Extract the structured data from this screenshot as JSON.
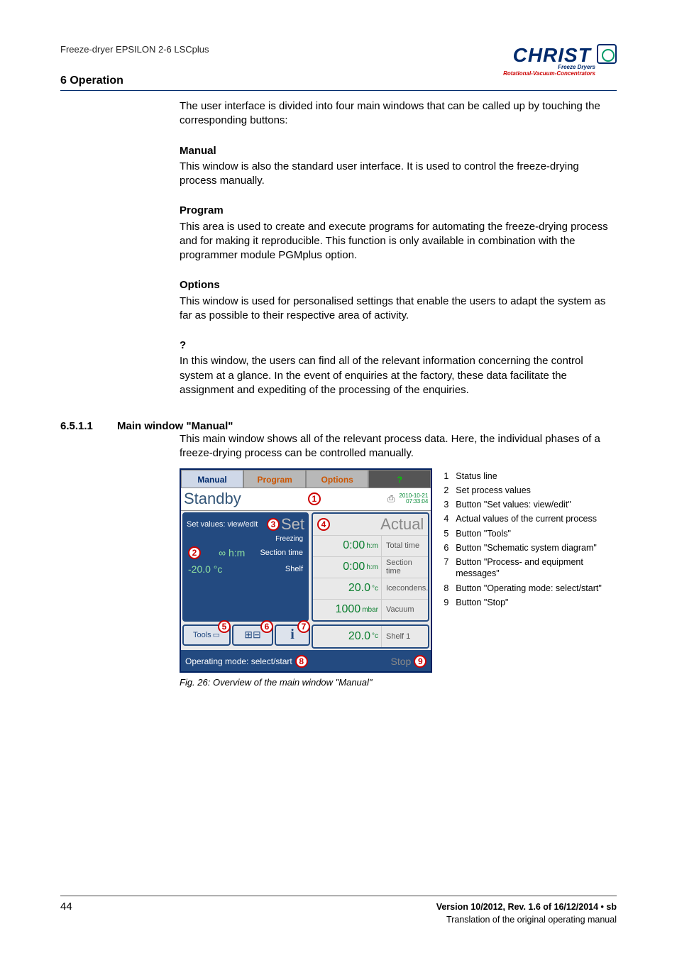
{
  "doc_title": "Freeze-dryer EPSILON 2-6 LSCplus",
  "section_title": "6 Operation",
  "logo": {
    "brand": "CHRIST",
    "sub1": "Freeze Dryers",
    "sub2": "Rotational-Vacuum-Concentrators"
  },
  "intro": "The user interface is divided into four main windows that can be called up by touching the corresponding buttons:",
  "blocks": [
    {
      "h": "Manual",
      "p": "This window is also the standard user interface. It is used to control the freeze-drying process manually."
    },
    {
      "h": "Program",
      "p": "This area is used to create and execute programs for automating the freeze-drying process and for making it reproducible. This function is only available in combination with the programmer module PGMplus option."
    },
    {
      "h": "Options",
      "p": "This window is used for personalised settings that enable the users to adapt the system as far as possible to their respective area of activity."
    },
    {
      "h": "?",
      "p": "In this window, the users can find all of the relevant information concerning the control system at a glance. In the event of enquiries at the factory, these data facilitate the assignment and expediting of the processing of the enquiries."
    }
  ],
  "subsection": {
    "num": "6.5.1.1",
    "title": "Main window \"Manual\"",
    "desc": "This main window shows all of the relevant process data. Here, the individual phases of a freeze-drying process can be controlled manually."
  },
  "screenshot": {
    "tabs": {
      "manual": "Manual",
      "program": "Program",
      "options": "Options",
      "q": "?"
    },
    "status": "Standby",
    "date": "2010-10-21",
    "time": "07:33:04",
    "set_header": "Set values: view/edit",
    "set_big": "Set",
    "freezing": "Freezing",
    "set_rows": [
      {
        "val": "∞ h:m",
        "lbl": "Section time"
      },
      {
        "val": "-20.0 °c",
        "lbl": "Shelf"
      }
    ],
    "actual_big": "Actual",
    "actual_rows": [
      {
        "val": "0:00",
        "unit": "h:m",
        "lbl": "Total time"
      },
      {
        "val": "0:00",
        "unit": "h:m",
        "lbl": "Section time"
      },
      {
        "val": "20.0",
        "unit": "°c",
        "lbl": "Icecondens."
      },
      {
        "val": "1000",
        "unit": "mbar",
        "lbl": "Vacuum"
      },
      {
        "val": "20.0",
        "unit": "°c",
        "lbl": "Shelf 1"
      }
    ],
    "tools_label": "Tools",
    "bottom_left": "Operating mode: select/start",
    "bottom_right": "Stop"
  },
  "legend": [
    {
      "n": "1",
      "t": "Status line"
    },
    {
      "n": "2",
      "t": "Set process values"
    },
    {
      "n": "3",
      "t": "Button \"Set values: view/edit\""
    },
    {
      "n": "4",
      "t": "Actual values of the current process"
    },
    {
      "n": "5",
      "t": "Button \"Tools\""
    },
    {
      "n": "6",
      "t": "Button \"Schematic system diagram\""
    },
    {
      "n": "7",
      "t": "Button \"Process- and equipment messages\""
    },
    {
      "n": "8",
      "t": "Button \"Operating mode: select/start\""
    },
    {
      "n": "9",
      "t": "Button \"Stop\""
    }
  ],
  "fig_caption": "Fig. 26: Overview of the main window \"Manual\"",
  "footer": {
    "page": "44",
    "version": "Version 10/2012, Rev. 1.6 of 16/12/2014 • sb",
    "trans": "Translation of the original operating manual"
  }
}
